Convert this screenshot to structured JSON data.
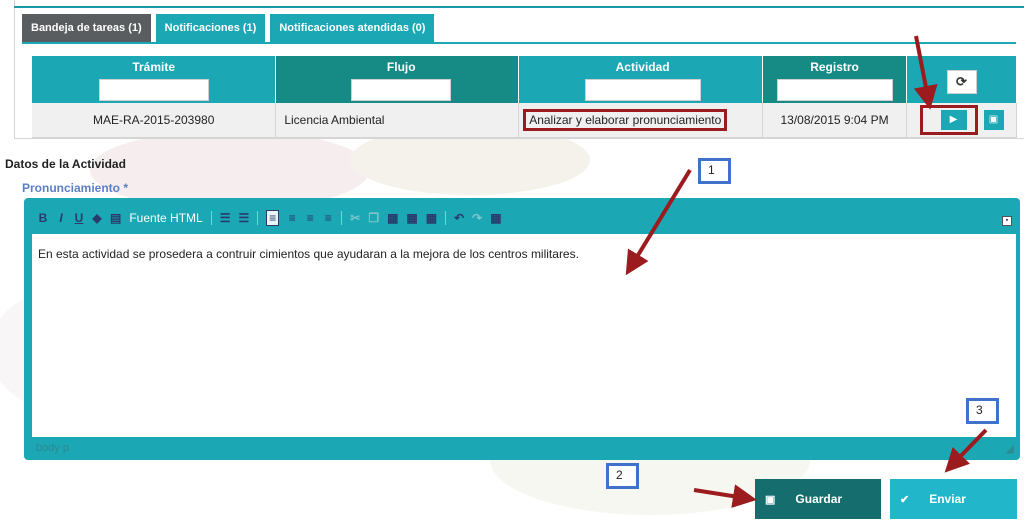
{
  "tabs": [
    {
      "label": "Bandeja de tareas (1)",
      "active": true
    },
    {
      "label": "Notificaciones (1)",
      "active": false
    },
    {
      "label": "Notificaciones atendidas (0)",
      "active": false
    }
  ],
  "table": {
    "columns": [
      "Trámite",
      "Flujo",
      "Actividad",
      "Registro"
    ],
    "rows": [
      {
        "tramite": "MAE-RA-2015-203980",
        "flujo": "Licencia Ambiental",
        "actividad": "Analizar y elaborar pronunciamiento",
        "registro": "13/08/2015 9:04 PM"
      }
    ],
    "refresh_icon": "⟳",
    "play_icon": "▶",
    "edit_icon": "▣"
  },
  "section": {
    "title": "Datos de la Actividad",
    "field_label": "Pronunciamiento *"
  },
  "editor": {
    "toolbar": {
      "bold": "B",
      "italic": "I",
      "underline": "U",
      "html_label": "Fuente HTML"
    },
    "content": "En esta actividad se prosedera a contruir cimientos que ayudaran a la mejora de los centros militares.",
    "status_path": "body  p"
  },
  "buttons": {
    "save": "Guardar",
    "send": "Enviar",
    "save_icon": "▣",
    "send_icon": "✔"
  },
  "annotations": [
    "1",
    "2",
    "3"
  ],
  "colors": {
    "accent": "#1ba7b4",
    "dark_header": "#168a84",
    "save_button": "#156d6e",
    "send_button": "#22b6cb",
    "highlight": "#9b1b1f",
    "callout": "#3f72c8"
  }
}
